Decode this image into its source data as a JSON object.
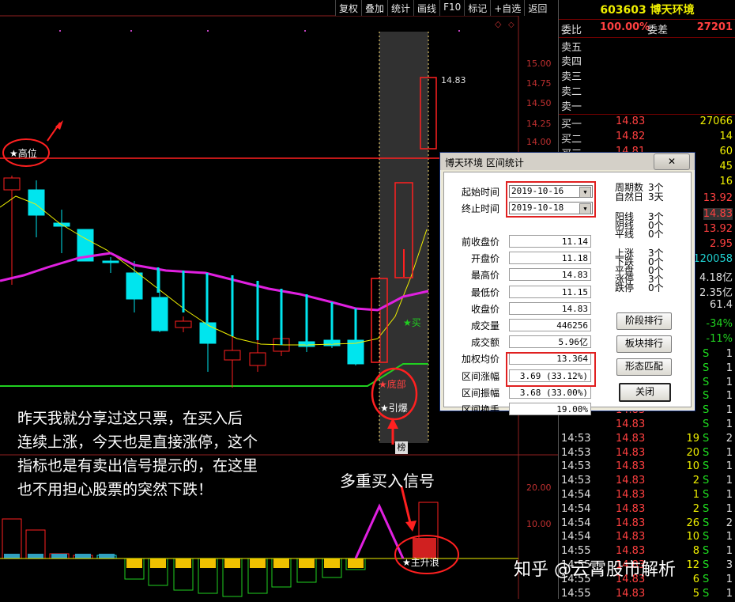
{
  "toolbar": {
    "items": [
      "复权",
      "叠加",
      "统计",
      "画线",
      "F10",
      "标记",
      "+自选",
      "返回"
    ]
  },
  "stock": {
    "code_name": "603603 博天环境"
  },
  "orderbook": {
    "weibi_label": "委比",
    "weibi_value": "100.00%",
    "weicha_label": "委差",
    "weicha_value": "27201",
    "sell_labels": [
      "卖五",
      "卖四",
      "卖三",
      "卖二",
      "卖一"
    ],
    "buy": [
      {
        "label": "买一",
        "price": "14.83",
        "vol": "27066"
      },
      {
        "label": "买二",
        "price": "14.82",
        "vol": "14"
      },
      {
        "label": "买三",
        "price": "14.81",
        "vol": "60"
      }
    ],
    "right_values": [
      "45",
      "16",
      "13.92",
      "14.83",
      "13.92",
      "2.95",
      "120058",
      "4.18亿",
      "2.35亿",
      "61.4",
      "-34%",
      "-11%"
    ]
  },
  "ticks": [
    {
      "t": "",
      "p": "14.83",
      "v": "",
      "s": "S",
      "n": "1"
    },
    {
      "t": "",
      "p": "14.83",
      "v": "",
      "s": "S",
      "n": "1"
    },
    {
      "t": "",
      "p": "14.83",
      "v": "",
      "s": "S",
      "n": "1"
    },
    {
      "t": "",
      "p": "14.83",
      "v": "",
      "s": "S",
      "n": "1"
    },
    {
      "t": "",
      "p": "14.83",
      "v": "",
      "s": "S",
      "n": "1"
    },
    {
      "t": "",
      "p": "14.83",
      "v": "",
      "s": "S",
      "n": "1"
    },
    {
      "t": "14:53",
      "p": "14.83",
      "v": "19",
      "s": "S",
      "n": "2"
    },
    {
      "t": "14:53",
      "p": "14.83",
      "v": "20",
      "s": "S",
      "n": "1"
    },
    {
      "t": "14:53",
      "p": "14.83",
      "v": "10",
      "s": "S",
      "n": "1"
    },
    {
      "t": "14:53",
      "p": "14.83",
      "v": "2",
      "s": "S",
      "n": "1"
    },
    {
      "t": "14:54",
      "p": "14.83",
      "v": "1",
      "s": "S",
      "n": "1"
    },
    {
      "t": "14:54",
      "p": "14.83",
      "v": "2",
      "s": "S",
      "n": "1"
    },
    {
      "t": "14:54",
      "p": "14.83",
      "v": "26",
      "s": "S",
      "n": "2"
    },
    {
      "t": "14:54",
      "p": "14.83",
      "v": "10",
      "s": "S",
      "n": "1"
    },
    {
      "t": "14:55",
      "p": "14.83",
      "v": "8",
      "s": "S",
      "n": "1"
    },
    {
      "t": "14:55",
      "p": "14.83",
      "v": "12",
      "s": "S",
      "n": "3"
    },
    {
      "t": "14:55",
      "p": "14.83",
      "v": "6",
      "s": "S",
      "n": "1"
    },
    {
      "t": "14:55",
      "p": "14.83",
      "v": "5",
      "s": "S",
      "n": "1"
    }
  ],
  "price_axis": [
    "15.00",
    "14.75",
    "14.50",
    "14.25",
    "14.00"
  ],
  "last_price_label": "14.83",
  "volume_axis": [
    "20.00",
    "10.00"
  ],
  "markers": {
    "high": "★高位",
    "buy": "★买",
    "bottom": "★底部",
    "ignite": "★引爆",
    "rise": "★主升浪",
    "bang": "榜"
  },
  "dialog": {
    "title": "博天环境 区间统计",
    "close_x": "✕",
    "start_label": "起始时间",
    "start_value": "2019-10-16",
    "end_label": "终止时间",
    "end_value": "2019-10-18",
    "fields": [
      {
        "label": "前收盘价",
        "value": "11.14"
      },
      {
        "label": "开盘价",
        "value": "11.18"
      },
      {
        "label": "最高价",
        "value": "14.83"
      },
      {
        "label": "最低价",
        "value": "11.15"
      },
      {
        "label": "收盘价",
        "value": "14.83"
      },
      {
        "label": "成交量",
        "value": "446256"
      },
      {
        "label": "成交额",
        "value": "5.96亿"
      },
      {
        "label": "加权均价",
        "value": "13.364"
      },
      {
        "label": "区间涨幅",
        "value": "3.69 (33.12%)"
      },
      {
        "label": "区间振幅",
        "value": "3.68 (33.00%)"
      },
      {
        "label": "区间换手",
        "value": "19.00%"
      }
    ],
    "stats": [
      {
        "label": "周期数",
        "value": "3个"
      },
      {
        "label": "自然日",
        "value": "3天"
      },
      {
        "label": "阳线",
        "value": "3个"
      },
      {
        "label": "阴线",
        "value": "0个"
      },
      {
        "label": "平线",
        "value": "0个"
      },
      {
        "label": "上涨",
        "value": "3个"
      },
      {
        "label": "下跌",
        "value": "0个"
      },
      {
        "label": "平盘",
        "value": "0个"
      },
      {
        "label": "涨停",
        "value": "3个"
      },
      {
        "label": "跌停",
        "value": "0个"
      }
    ],
    "buttons": [
      "阶段排行",
      "板块排行",
      "形态匹配",
      "关闭"
    ]
  },
  "annotation": {
    "lines": [
      "昨天我就分享过这只票，在买入后",
      "连续上涨，今天也是直接涨停，这个",
      "指标也是有卖出信号提示的，在这里",
      "也不用担心股票的突然下跌！"
    ],
    "multi_signal": "多重买入信号",
    "watermark": "知乎 @云霄股市解析"
  },
  "colors": {
    "up": "#ff2020",
    "down": "#00e5ee",
    "ma_yellow": "#f0f000",
    "ma_magenta": "#e020e0",
    "green": "#20d020"
  }
}
